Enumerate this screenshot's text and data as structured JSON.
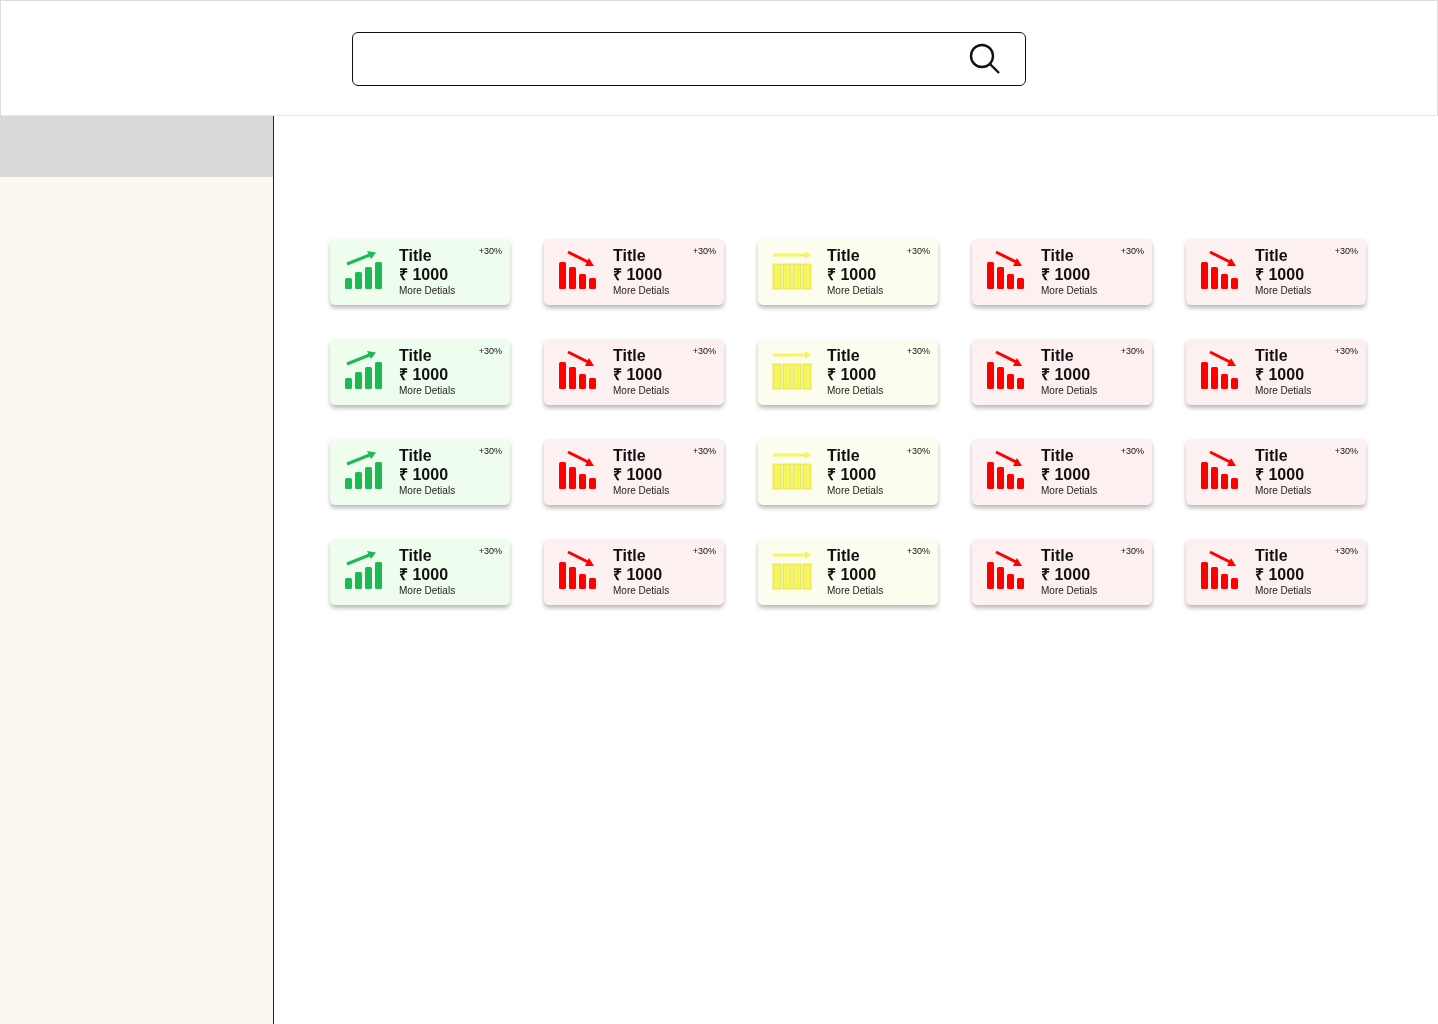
{
  "cards": [
    {
      "kind": "up",
      "title": "Title",
      "change": "+30%",
      "amount": "₹ 1000",
      "link": "More Detials"
    },
    {
      "kind": "down",
      "title": "Title",
      "change": "+30%",
      "amount": "₹ 1000",
      "link": "More Detials"
    },
    {
      "kind": "flat",
      "title": "Title",
      "change": "+30%",
      "amount": "₹ 1000",
      "link": "More Detials"
    },
    {
      "kind": "down",
      "title": "Title",
      "change": "+30%",
      "amount": "₹ 1000",
      "link": "More Detials"
    },
    {
      "kind": "down",
      "title": "Title",
      "change": "+30%",
      "amount": "₹ 1000",
      "link": "More Detials"
    },
    {
      "kind": "up",
      "title": "Title",
      "change": "+30%",
      "amount": "₹ 1000",
      "link": "More Detials"
    },
    {
      "kind": "down",
      "title": "Title",
      "change": "+30%",
      "amount": "₹ 1000",
      "link": "More Detials"
    },
    {
      "kind": "flat",
      "title": "Title",
      "change": "+30%",
      "amount": "₹ 1000",
      "link": "More Detials"
    },
    {
      "kind": "down",
      "title": "Title",
      "change": "+30%",
      "amount": "₹ 1000",
      "link": "More Detials"
    },
    {
      "kind": "down",
      "title": "Title",
      "change": "+30%",
      "amount": "₹ 1000",
      "link": "More Detials"
    },
    {
      "kind": "up",
      "title": "Title",
      "change": "+30%",
      "amount": "₹ 1000",
      "link": "More Detials"
    },
    {
      "kind": "down",
      "title": "Title",
      "change": "+30%",
      "amount": "₹ 1000",
      "link": "More Detials"
    },
    {
      "kind": "flat",
      "title": "Title",
      "change": "+30%",
      "amount": "₹ 1000",
      "link": "More Detials"
    },
    {
      "kind": "down",
      "title": "Title",
      "change": "+30%",
      "amount": "₹ 1000",
      "link": "More Detials"
    },
    {
      "kind": "down",
      "title": "Title",
      "change": "+30%",
      "amount": "₹ 1000",
      "link": "More Detials"
    },
    {
      "kind": "up",
      "title": "Title",
      "change": "+30%",
      "amount": "₹ 1000",
      "link": "More Detials"
    },
    {
      "kind": "down",
      "title": "Title",
      "change": "+30%",
      "amount": "₹ 1000",
      "link": "More Detials"
    },
    {
      "kind": "flat",
      "title": "Title",
      "change": "+30%",
      "amount": "₹ 1000",
      "link": "More Detials"
    },
    {
      "kind": "down",
      "title": "Title",
      "change": "+30%",
      "amount": "₹ 1000",
      "link": "More Detials"
    },
    {
      "kind": "down",
      "title": "Title",
      "change": "+30%",
      "amount": "₹ 1000",
      "link": "More Detials"
    }
  ]
}
